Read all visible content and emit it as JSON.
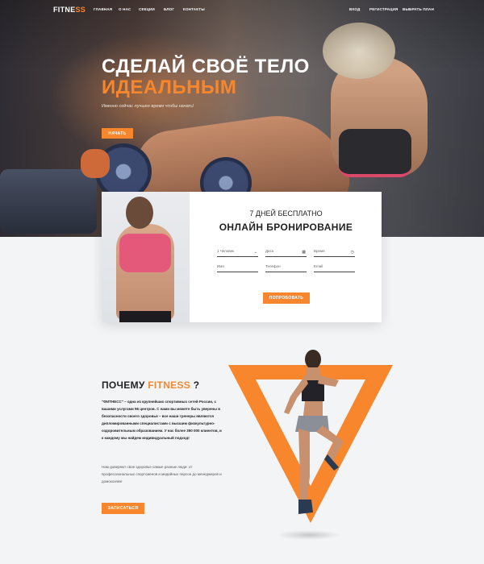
{
  "brand": {
    "logo_main": "FITNE",
    "logo_accent": "SS",
    "accent_color": "#f7862c"
  },
  "nav": {
    "items": [
      "ГЛАВНАЯ",
      "О НАС",
      "СЕКЦИИ",
      "БЛОГ",
      "КОНТАКТЫ"
    ],
    "right": [
      "ВХОД",
      "РЕГИСТРАЦИЯ",
      "ВЫБРАТЬ ПЛАН"
    ]
  },
  "hero": {
    "title_line1": "СДЕЛАЙ СВОЁ ТЕЛО",
    "title_line2": "ИДЕАЛЬНЫМ",
    "subtitle": "Именно сейчас лучшее время чтобы начать!",
    "cta": "НАЧАТЬ"
  },
  "booking": {
    "line1": "7 ДНЕЙ БЕСПЛАТНО",
    "line2": "ОНЛАЙН БРОНИРОВАНИЕ",
    "fields": {
      "people": "1 Человек",
      "date": "Дата",
      "time": "Время",
      "name": "Имя",
      "phone": "Телефон",
      "email": "Email"
    },
    "submit": "ПОПРОБОВАТЬ"
  },
  "why": {
    "title_prefix": "ПОЧЕМУ ",
    "title_accent": "FITNESS",
    "title_suffix": " ?",
    "paragraph1": "\"ФИТНЕСС\" – одна из крупнейших спортивных сетей России, с вашими услугами 96 центров. С нами вы можете быть уверены в безопасности своего здоровья – все наши тренеры являются дипломированными специалистами с высшим физкультурно-оздоровительным образованием. У нас более 390 000 клиентов, и к каждому мы найдем индивидуальный подход!",
    "paragraph2": "Нам доверяют свое здоровье самые разные люди: от профессиональных спортсменов и медийных персон до менеджеров и домохозяек!",
    "cta": "ЗАПИСАТЬСЯ"
  }
}
